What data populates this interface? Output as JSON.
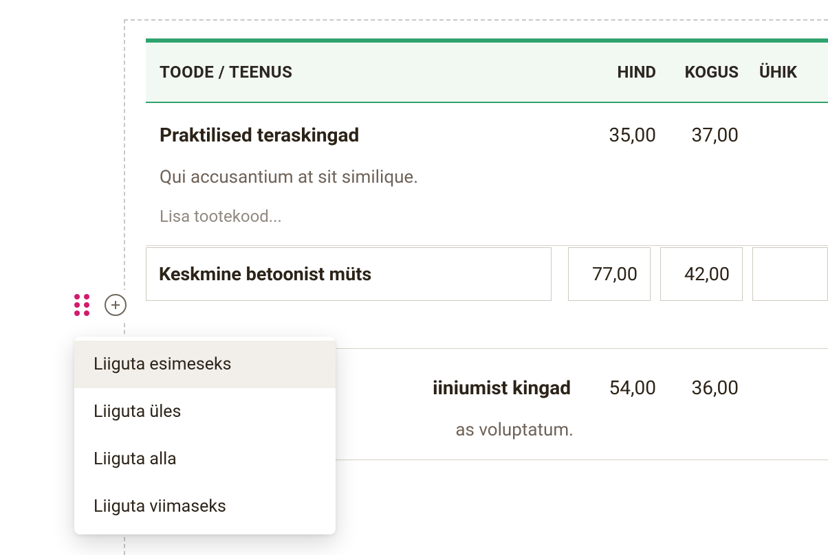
{
  "table": {
    "headers": {
      "product": "TOODE / TEENUS",
      "price": "HIND",
      "qty": "KOGUS",
      "unit": "ÜHIK"
    },
    "rows": [
      {
        "name": "Praktilised teraskingad",
        "price": "35,00",
        "qty": "37,00",
        "desc": "Qui accusantium at sit similique.",
        "code_placeholder": "Lisa tootekood..."
      },
      {
        "name": "Keskmine betoonist müts",
        "price": "77,00",
        "qty": "42,00"
      },
      {
        "name_suffix": "iiniumist kingad",
        "price": "54,00",
        "qty": "36,00",
        "desc_suffix": "as voluptatum."
      }
    ]
  },
  "menu": {
    "items": [
      "Liiguta esimeseks",
      "Liiguta üles",
      "Liiguta alla",
      "Liiguta viimaseks"
    ]
  }
}
